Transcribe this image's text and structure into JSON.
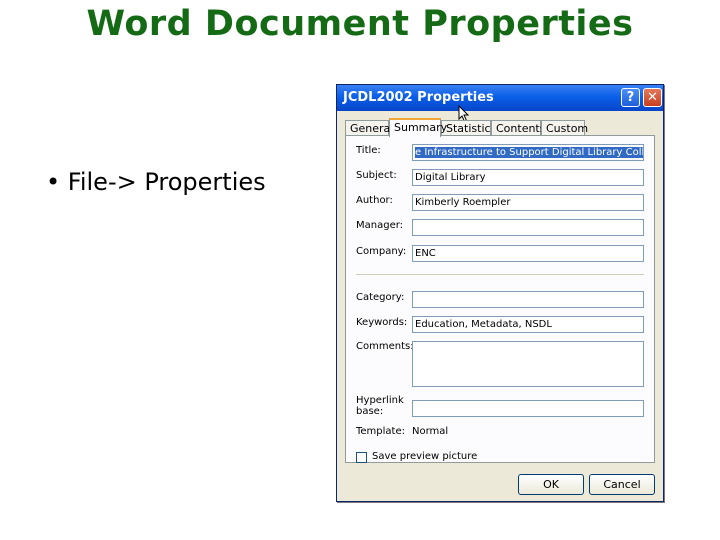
{
  "slide": {
    "title": "Word Document Properties",
    "bullet": "• File-> Properties"
  },
  "dialog": {
    "title": "JCDL2002 Properties",
    "help_icon": "?",
    "close_icon": "✕",
    "tabs": [
      "General",
      "Summary",
      "Statistics",
      "Contents",
      "Custom"
    ],
    "active_tab": "Summary",
    "fields": {
      "title_label": "Title:",
      "title_value": "e Infrastructure to Support Digital Library Collections",
      "subject_label": "Subject:",
      "subject_value": "Digital Library",
      "author_label": "Author:",
      "author_value": "Kimberly Roempler",
      "manager_label": "Manager:",
      "manager_value": "",
      "company_label": "Company:",
      "company_value": "ENC",
      "category_label": "Category:",
      "category_value": "",
      "keywords_label": "Keywords:",
      "keywords_value": "Education, Metadata, NSDL",
      "comments_label": "Comments:",
      "comments_value": "",
      "hyperlink_label_1": "Hyperlink",
      "hyperlink_label_2": "base:",
      "hyperlink_value": "",
      "template_label": "Template:",
      "template_value": "Normal"
    },
    "save_preview_label": "Save preview picture",
    "save_preview_checked": false,
    "ok_label": "OK",
    "cancel_label": "Cancel"
  },
  "colors": {
    "title_green": "#156b15",
    "titlebar_blue": "#0a5fe8",
    "dialog_bg": "#ece9d8"
  }
}
